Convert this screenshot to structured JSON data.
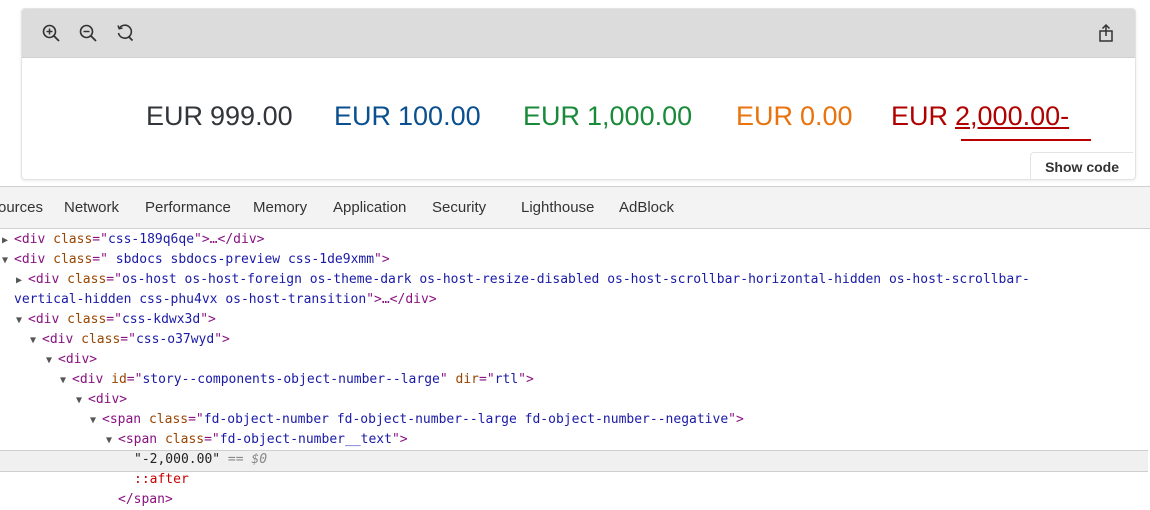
{
  "preview": {
    "toolbar": {
      "zoom_in_icon": "zoom-in-icon",
      "zoom_out_icon": "zoom-out-icon",
      "reset_zoom_icon": "reset-zoom-icon",
      "share_icon": "share-icon"
    },
    "numbers": [
      {
        "currency": "EUR",
        "value": "999.00",
        "color": "#32363a"
      },
      {
        "currency": "EUR",
        "value": "100.00",
        "color": "#0a4f8f"
      },
      {
        "currency": "EUR",
        "value": "1,000.00",
        "color": "#1a8a3a"
      },
      {
        "currency": "EUR",
        "value": "0.00",
        "color": "#e9730c"
      },
      {
        "currency": "EUR",
        "value": "2,000.00-",
        "color": "#b00000"
      }
    ],
    "show_code_label": "Show code"
  },
  "devtools": {
    "tabs": [
      "ources",
      "Network",
      "Performance",
      "Memory",
      "Application",
      "Security",
      "Lighthouse",
      "AdBlock"
    ],
    "dom": {
      "l1": {
        "tag_open": "<div",
        "attr": "class",
        "eq": "=\"",
        "val": "css-189q6qe",
        "close": "\">…</div>"
      },
      "l2": {
        "tag_open": "<div",
        "attr": "class",
        "val": " sbdocs sbdocs-preview css-1de9xmm",
        "close": ">"
      },
      "l3a": {
        "tag_open": "<div",
        "attr": "class",
        "val": "os-host os-host-foreign os-theme-dark os-host-resize-disabled os-host-scrollbar-horizontal-hidden os-host-scrollbar-"
      },
      "l3b": {
        "val": "vertical-hidden css-phu4vx os-host-transition",
        "close": ">…</div>"
      },
      "l4": {
        "tag_open": "<div",
        "attr": "class",
        "val": "css-kdwx3d",
        "close": ">"
      },
      "l5": {
        "tag_open": "<div",
        "attr": "class",
        "val": "css-o37wyd",
        "close": ">"
      },
      "l6": {
        "tag": "<div>"
      },
      "l7": {
        "tag_open": "<div",
        "attr1": "id",
        "val1": "story--components-object-number--large",
        "attr2": "dir",
        "val2": "rtl",
        "close": ">"
      },
      "l8": {
        "tag": "<div>"
      },
      "l9": {
        "tag_open": "<span",
        "attr": "class",
        "val": "fd-object-number fd-object-number--large fd-object-number--negative",
        "close": ">"
      },
      "l10": {
        "tag_open": "<span",
        "attr": "class",
        "val": "fd-object-number__text",
        "close": ">"
      },
      "l11": {
        "text": "\"-2,000.00\"",
        "eq": "== $0"
      },
      "l12": {
        "pseudo": "::after"
      },
      "l13": {
        "tag": "</span>"
      }
    }
  }
}
